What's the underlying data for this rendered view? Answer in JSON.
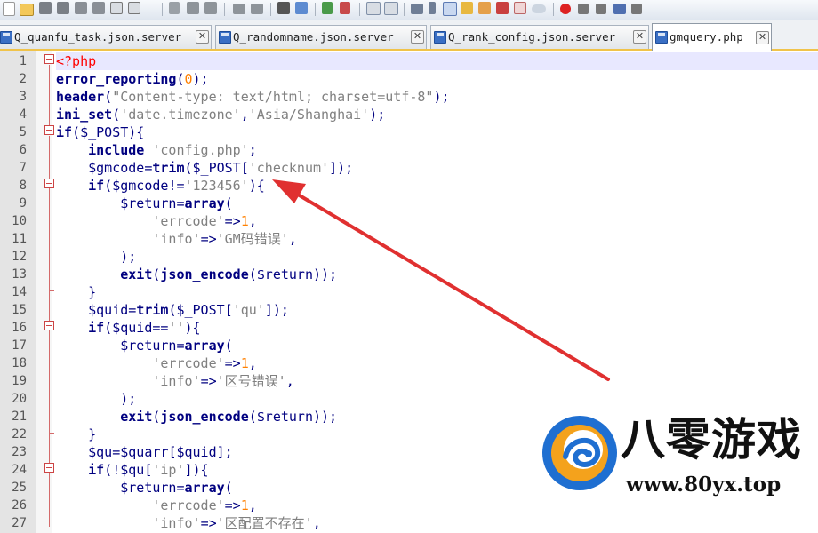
{
  "tabs": [
    {
      "label": "Q_quanfu_task.json.server",
      "active": false
    },
    {
      "label": "Q_randomname.json.server",
      "active": false
    },
    {
      "label": "Q_rank_config.json.server",
      "active": false
    },
    {
      "label": "gmquery.php",
      "active": true
    }
  ],
  "tab_close_glyph": "✕",
  "editor": {
    "line_numbers": [
      "1",
      "2",
      "3",
      "4",
      "5",
      "6",
      "7",
      "8",
      "9",
      "10",
      "11",
      "12",
      "13",
      "14",
      "15",
      "16",
      "17",
      "18",
      "19",
      "20",
      "21",
      "22",
      "23",
      "24",
      "25",
      "26",
      "27"
    ],
    "lines": [
      [
        {
          "t": "<?php",
          "c": "php"
        }
      ],
      [
        {
          "t": "error_reporting",
          "c": "fn"
        },
        {
          "t": "(",
          "c": "op"
        },
        {
          "t": "0",
          "c": "num"
        },
        {
          "t": ");",
          "c": "op"
        }
      ],
      [
        {
          "t": "header",
          "c": "fn"
        },
        {
          "t": "(",
          "c": "op"
        },
        {
          "t": "\"Content-type: text/html; charset=utf-8\"",
          "c": "str"
        },
        {
          "t": ");",
          "c": "op"
        }
      ],
      [
        {
          "t": "ini_set",
          "c": "fn"
        },
        {
          "t": "(",
          "c": "op"
        },
        {
          "t": "'date.timezone'",
          "c": "str"
        },
        {
          "t": ",",
          "c": "op"
        },
        {
          "t": "'Asia/Shanghai'",
          "c": "str"
        },
        {
          "t": ");",
          "c": "op"
        }
      ],
      [
        {
          "t": "if",
          "c": "kw"
        },
        {
          "t": "(",
          "c": "op"
        },
        {
          "t": "$_POST",
          "c": "var"
        },
        {
          "t": "){",
          "c": "op"
        }
      ],
      [
        {
          "t": "    ",
          "c": "plain"
        },
        {
          "t": "include",
          "c": "kw"
        },
        {
          "t": " ",
          "c": "plain"
        },
        {
          "t": "'config.php'",
          "c": "str"
        },
        {
          "t": ";",
          "c": "op"
        }
      ],
      [
        {
          "t": "    ",
          "c": "plain"
        },
        {
          "t": "$gmcode",
          "c": "var"
        },
        {
          "t": "=",
          "c": "op"
        },
        {
          "t": "trim",
          "c": "fn"
        },
        {
          "t": "(",
          "c": "op"
        },
        {
          "t": "$_POST",
          "c": "var"
        },
        {
          "t": "[",
          "c": "op"
        },
        {
          "t": "'checknum'",
          "c": "str"
        },
        {
          "t": "]);",
          "c": "op"
        }
      ],
      [
        {
          "t": "    ",
          "c": "plain"
        },
        {
          "t": "if",
          "c": "kw"
        },
        {
          "t": "(",
          "c": "op"
        },
        {
          "t": "$gmcode",
          "c": "var"
        },
        {
          "t": "!=",
          "c": "op"
        },
        {
          "t": "'123456'",
          "c": "str"
        },
        {
          "t": "){",
          "c": "op"
        }
      ],
      [
        {
          "t": "        ",
          "c": "plain"
        },
        {
          "t": "$return",
          "c": "var"
        },
        {
          "t": "=",
          "c": "op"
        },
        {
          "t": "array",
          "c": "kw"
        },
        {
          "t": "(",
          "c": "op"
        }
      ],
      [
        {
          "t": "            ",
          "c": "plain"
        },
        {
          "t": "'errcode'",
          "c": "str"
        },
        {
          "t": "=>",
          "c": "op"
        },
        {
          "t": "1",
          "c": "num"
        },
        {
          "t": ",",
          "c": "op"
        }
      ],
      [
        {
          "t": "            ",
          "c": "plain"
        },
        {
          "t": "'info'",
          "c": "str"
        },
        {
          "t": "=>",
          "c": "op"
        },
        {
          "t": "'GM码错误'",
          "c": "str"
        },
        {
          "t": ",",
          "c": "op"
        }
      ],
      [
        {
          "t": "        ",
          "c": "plain"
        },
        {
          "t": ");",
          "c": "op"
        }
      ],
      [
        {
          "t": "        ",
          "c": "plain"
        },
        {
          "t": "exit",
          "c": "kw"
        },
        {
          "t": "(",
          "c": "op"
        },
        {
          "t": "json_encode",
          "c": "fn"
        },
        {
          "t": "(",
          "c": "op"
        },
        {
          "t": "$return",
          "c": "var"
        },
        {
          "t": "));",
          "c": "op"
        }
      ],
      [
        {
          "t": "    ",
          "c": "plain"
        },
        {
          "t": "}",
          "c": "op"
        }
      ],
      [
        {
          "t": "    ",
          "c": "plain"
        },
        {
          "t": "$quid",
          "c": "var"
        },
        {
          "t": "=",
          "c": "op"
        },
        {
          "t": "trim",
          "c": "fn"
        },
        {
          "t": "(",
          "c": "op"
        },
        {
          "t": "$_POST",
          "c": "var"
        },
        {
          "t": "[",
          "c": "op"
        },
        {
          "t": "'qu'",
          "c": "str"
        },
        {
          "t": "]);",
          "c": "op"
        }
      ],
      [
        {
          "t": "    ",
          "c": "plain"
        },
        {
          "t": "if",
          "c": "kw"
        },
        {
          "t": "(",
          "c": "op"
        },
        {
          "t": "$quid",
          "c": "var"
        },
        {
          "t": "==",
          "c": "op"
        },
        {
          "t": "''",
          "c": "str"
        },
        {
          "t": "){",
          "c": "op"
        }
      ],
      [
        {
          "t": "        ",
          "c": "plain"
        },
        {
          "t": "$return",
          "c": "var"
        },
        {
          "t": "=",
          "c": "op"
        },
        {
          "t": "array",
          "c": "kw"
        },
        {
          "t": "(",
          "c": "op"
        }
      ],
      [
        {
          "t": "            ",
          "c": "plain"
        },
        {
          "t": "'errcode'",
          "c": "str"
        },
        {
          "t": "=>",
          "c": "op"
        },
        {
          "t": "1",
          "c": "num"
        },
        {
          "t": ",",
          "c": "op"
        }
      ],
      [
        {
          "t": "            ",
          "c": "plain"
        },
        {
          "t": "'info'",
          "c": "str"
        },
        {
          "t": "=>",
          "c": "op"
        },
        {
          "t": "'区号错误'",
          "c": "str"
        },
        {
          "t": ",",
          "c": "op"
        }
      ],
      [
        {
          "t": "        ",
          "c": "plain"
        },
        {
          "t": ");",
          "c": "op"
        }
      ],
      [
        {
          "t": "        ",
          "c": "plain"
        },
        {
          "t": "exit",
          "c": "kw"
        },
        {
          "t": "(",
          "c": "op"
        },
        {
          "t": "json_encode",
          "c": "fn"
        },
        {
          "t": "(",
          "c": "op"
        },
        {
          "t": "$return",
          "c": "var"
        },
        {
          "t": "));",
          "c": "op"
        }
      ],
      [
        {
          "t": "    ",
          "c": "plain"
        },
        {
          "t": "}",
          "c": "op"
        }
      ],
      [
        {
          "t": "    ",
          "c": "plain"
        },
        {
          "t": "$qu",
          "c": "var"
        },
        {
          "t": "=",
          "c": "op"
        },
        {
          "t": "$quarr",
          "c": "var"
        },
        {
          "t": "[",
          "c": "op"
        },
        {
          "t": "$quid",
          "c": "var"
        },
        {
          "t": "];",
          "c": "op"
        }
      ],
      [
        {
          "t": "    ",
          "c": "plain"
        },
        {
          "t": "if",
          "c": "kw"
        },
        {
          "t": "(!",
          "c": "op"
        },
        {
          "t": "$qu",
          "c": "var"
        },
        {
          "t": "[",
          "c": "op"
        },
        {
          "t": "'ip'",
          "c": "str"
        },
        {
          "t": "]){",
          "c": "op"
        }
      ],
      [
        {
          "t": "        ",
          "c": "plain"
        },
        {
          "t": "$return",
          "c": "var"
        },
        {
          "t": "=",
          "c": "op"
        },
        {
          "t": "array",
          "c": "kw"
        },
        {
          "t": "(",
          "c": "op"
        }
      ],
      [
        {
          "t": "            ",
          "c": "plain"
        },
        {
          "t": "'errcode'",
          "c": "str"
        },
        {
          "t": "=>",
          "c": "op"
        },
        {
          "t": "1",
          "c": "num"
        },
        {
          "t": ",",
          "c": "op"
        }
      ],
      [
        {
          "t": "            ",
          "c": "plain"
        },
        {
          "t": "'info'",
          "c": "str"
        },
        {
          "t": "=>",
          "c": "op"
        },
        {
          "t": "'区配置不存在'",
          "c": "str"
        },
        {
          "t": ",",
          "c": "op"
        }
      ]
    ]
  },
  "logo": {
    "title": "八零游戏",
    "url": "www.80yx.top"
  },
  "colors": {
    "accent_tab_underline": "#f0c34a",
    "arrow": "#e03030",
    "php_tag": "#ff0000",
    "keyword": "#000080",
    "string": "#808080",
    "number": "#ff8000"
  }
}
